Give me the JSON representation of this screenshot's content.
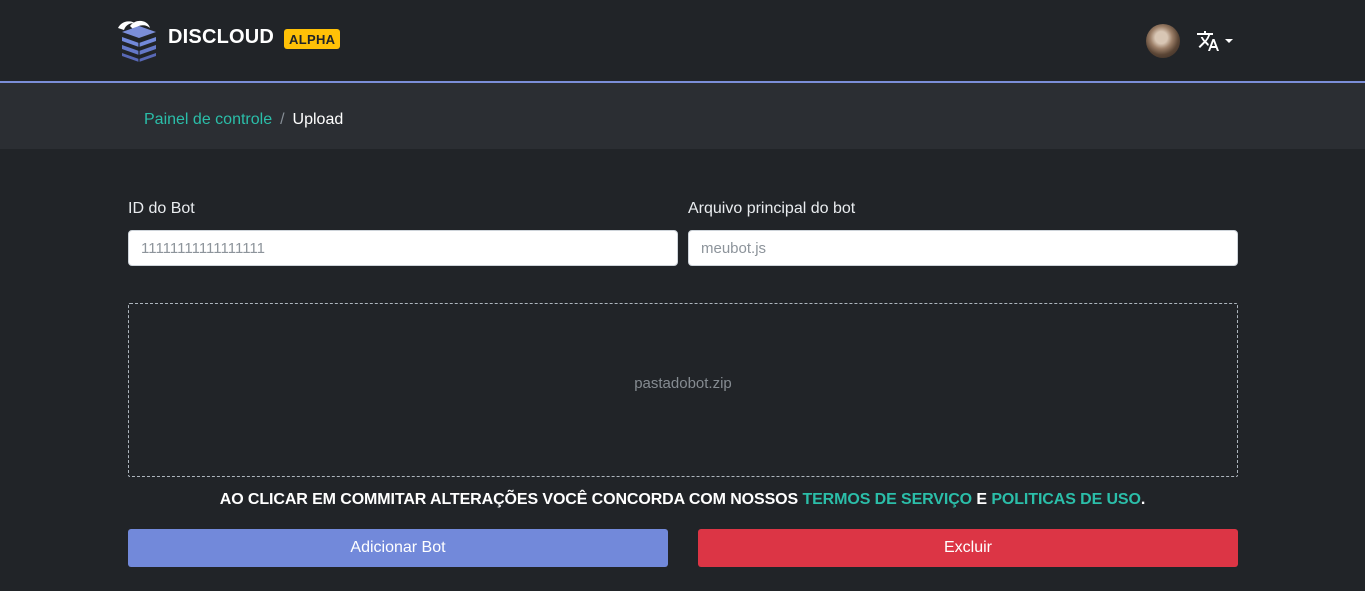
{
  "navbar": {
    "brand_name": "DISCLOUD",
    "badge": "ALPHA",
    "logo_icon": "discloud-logo-icon",
    "avatar_icon": "user-avatar",
    "language_icon": "translate-icon",
    "dropdown_icon": "caret-down-icon",
    "accent_color": "#7b8ed8"
  },
  "breadcrumb": {
    "link": "Painel de controle",
    "separator": "/",
    "current": "Upload"
  },
  "form": {
    "bot_id_label": "ID do Bot",
    "bot_id_placeholder": "11111111111111111",
    "main_file_label": "Arquivo principal do bot",
    "main_file_placeholder": "meubot.js",
    "dropzone_text": "pastadobot.zip"
  },
  "terms": {
    "prefix": "AO CLICAR EM COMMITAR ALTERAÇÕES VOCÊ CONCORDA COM NOSSOS",
    "terms_link": "TERMOS DE SERVIÇO",
    "conjunction": "E",
    "policies_link": "POLITICAS DE USO",
    "suffix": "."
  },
  "buttons": {
    "add_label": "Adicionar Bot",
    "delete_label": "Excluir",
    "add_color": "#7289da",
    "delete_color": "#dc3545"
  },
  "colors": {
    "background": "#212428",
    "link": "#2bbea9",
    "badge": "#ffc107"
  }
}
